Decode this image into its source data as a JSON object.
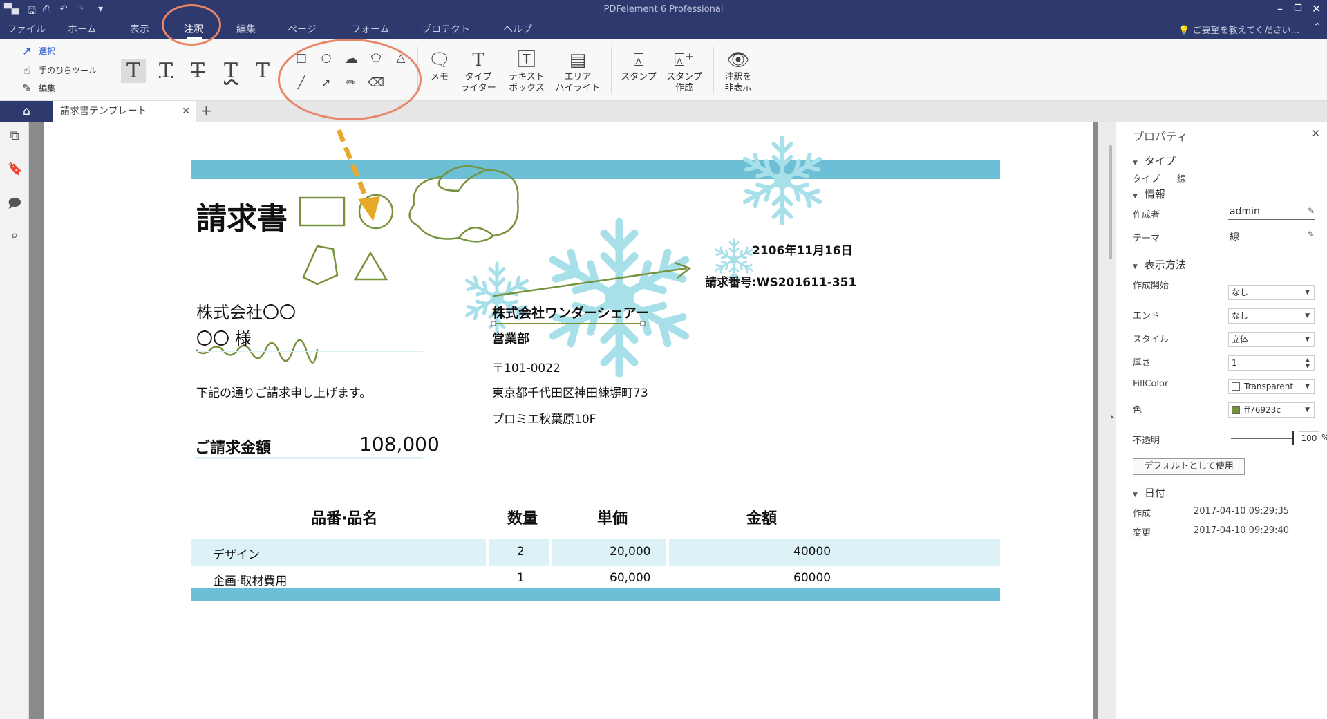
{
  "app": {
    "title": "PDFelement 6 Professional",
    "qat_icons": [
      "save-icon",
      "print-icon",
      "undo-icon",
      "redo-icon",
      "customize-icon"
    ]
  },
  "menu": {
    "items": [
      "ファイル",
      "ホーム",
      "表示",
      "注釈",
      "編集",
      "ページ",
      "フォーム",
      "プロテクト",
      "ヘルプ"
    ],
    "active": "注釈",
    "ask": "ご要望を教えてください..."
  },
  "ribbon": {
    "select": "選択",
    "hand": "手のひらツール",
    "edit": "編集",
    "memo": "メモ",
    "typewriter_1": "タイプ",
    "typewriter_2": "ライター",
    "textbox_1": "テキスト",
    "textbox_2": "ボックス",
    "area_1": "エリア",
    "area_2": "ハイライト",
    "stamp": "スタンプ",
    "stamp_create_1": "スタンプ",
    "stamp_create_2": "作成",
    "hide_1": "注釈を",
    "hide_2": "非表示"
  },
  "tabs": {
    "doc": "請求書テンプレート"
  },
  "document": {
    "title": "請求書",
    "date": "2106年11月16日",
    "invoice_no": "請求番号:WS201611-351",
    "client_company": "株式会社〇〇",
    "client_name": "〇〇 様",
    "issuer_company": "株式会社ワンダーシェアー",
    "issuer_dept": "営業部",
    "postal": "〒101-0022",
    "address": "東京都千代田区神田練塀町73",
    "building": "プロミエ秋葉原10F",
    "request_text": "下記の通りご請求申し上げます。",
    "amount_label": "ご請求金額",
    "amount_value": "108,000",
    "table_headers": [
      "品番·品名",
      "数量",
      "単価",
      "金額"
    ],
    "rows": [
      [
        "デザイン",
        "2",
        "20,000",
        "40000"
      ],
      [
        "企画·取材費用",
        "1",
        "60,000",
        "60000"
      ]
    ]
  },
  "properties": {
    "header": "プロパティ",
    "type_section": "タイプ",
    "type_label": "タイプ",
    "type_value": "線",
    "info_section": "情報",
    "author_label": "作成者",
    "author_value": "admin",
    "subject_label": "テーマ",
    "subject_value": "線",
    "display_section": "表示方法",
    "start_label": "作成開始",
    "start_value": "なし",
    "end_label": "エンド",
    "end_value": "なし",
    "style_label": "スタイル",
    "style_value": "立体",
    "thickness_label": "厚さ",
    "thickness_value": "1",
    "fill_label": "FillColor",
    "fill_value": "Transparent",
    "color_label": "色",
    "color_value": "ff76923c",
    "color_hex": "#76923c",
    "opacity_label": "不透明",
    "opacity_value": "100",
    "opacity_unit": "%",
    "default_button": "デフォルトとして使用",
    "date_section": "日付",
    "created_label": "作成",
    "created_value": "2017-04-10 09:29:35",
    "modified_label": "変更",
    "modified_value": "2017-04-10 09:29:40"
  },
  "colors": {
    "titlebar": "#2e3a6e",
    "band": "#6dbfd6",
    "annotation": "#76923c",
    "snowflake": "#a8e0ea",
    "callout": "#e8866a",
    "arrow": "#e8a92b"
  }
}
